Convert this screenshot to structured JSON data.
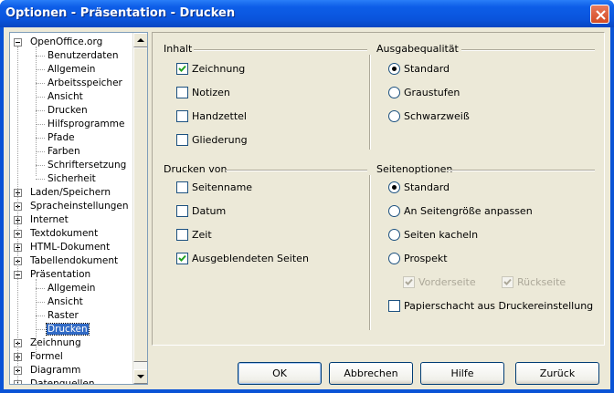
{
  "window": {
    "title": "Optionen - Präsentation - Drucken"
  },
  "tree": [
    {
      "label": "OpenOffice.org",
      "level": 0,
      "expander": "minus"
    },
    {
      "label": "Benutzerdaten",
      "level": 1
    },
    {
      "label": "Allgemein",
      "level": 1
    },
    {
      "label": "Arbeitsspeicher",
      "level": 1
    },
    {
      "label": "Ansicht",
      "level": 1
    },
    {
      "label": "Drucken",
      "level": 1
    },
    {
      "label": "Hilfsprogramme",
      "level": 1
    },
    {
      "label": "Pfade",
      "level": 1
    },
    {
      "label": "Farben",
      "level": 1
    },
    {
      "label": "Schriftersetzung",
      "level": 1
    },
    {
      "label": "Sicherheit",
      "level": 1
    },
    {
      "label": "Laden/Speichern",
      "level": 0,
      "expander": "plus"
    },
    {
      "label": "Spracheinstellungen",
      "level": 0,
      "expander": "plus"
    },
    {
      "label": "Internet",
      "level": 0,
      "expander": "plus"
    },
    {
      "label": "Textdokument",
      "level": 0,
      "expander": "plus"
    },
    {
      "label": "HTML-Dokument",
      "level": 0,
      "expander": "plus"
    },
    {
      "label": "Tabellendokument",
      "level": 0,
      "expander": "plus"
    },
    {
      "label": "Präsentation",
      "level": 0,
      "expander": "minus"
    },
    {
      "label": "Allgemein",
      "level": 1
    },
    {
      "label": "Ansicht",
      "level": 1
    },
    {
      "label": "Raster",
      "level": 1
    },
    {
      "label": "Drucken",
      "level": 1,
      "selected": true
    },
    {
      "label": "Zeichnung",
      "level": 0,
      "expander": "plus"
    },
    {
      "label": "Formel",
      "level": 0,
      "expander": "plus"
    },
    {
      "label": "Diagramm",
      "level": 0,
      "expander": "plus"
    },
    {
      "label": "Datenquellen",
      "level": 0,
      "expander": "plus"
    }
  ],
  "inhalt": {
    "title": "Inhalt",
    "items": [
      {
        "label": "Zeichnung",
        "checked": true
      },
      {
        "label": "Notizen",
        "checked": false
      },
      {
        "label": "Handzettel",
        "checked": false
      },
      {
        "label": "Gliederung",
        "checked": false
      }
    ]
  },
  "ausgabequalitaet": {
    "title": "Ausgabequalität",
    "items": [
      {
        "label": "Standard",
        "selected": true
      },
      {
        "label": "Graustufen",
        "selected": false
      },
      {
        "label": "Schwarzweiß",
        "selected": false
      }
    ]
  },
  "drucken_von": {
    "title": "Drucken von",
    "items": [
      {
        "label": "Seitenname",
        "checked": false
      },
      {
        "label": "Datum",
        "checked": false
      },
      {
        "label": "Zeit",
        "checked": false
      },
      {
        "label": "Ausgeblendeten Seiten",
        "checked": true
      }
    ]
  },
  "seitenoptionen": {
    "title": "Seitenoptionen",
    "radios": [
      {
        "label": "Standard",
        "selected": true
      },
      {
        "label": "An Seitengröße anpassen",
        "selected": false
      },
      {
        "label": "Seiten kacheln",
        "selected": false
      },
      {
        "label": "Prospekt",
        "selected": false
      }
    ],
    "sub": [
      {
        "label": "Vorderseite",
        "checked": true,
        "disabled": true
      },
      {
        "label": "Rückseite",
        "checked": true,
        "disabled": true
      }
    ],
    "papierschacht": {
      "label": "Papierschacht aus Druckereinstellung",
      "checked": false
    }
  },
  "buttons": {
    "ok": "OK",
    "cancel": "Abbrechen",
    "help": "Hilfe",
    "back": "Zurück"
  },
  "colors": {
    "titlebar": "#0a54dc",
    "face": "#ece9d8",
    "selection": "#316ac5"
  }
}
